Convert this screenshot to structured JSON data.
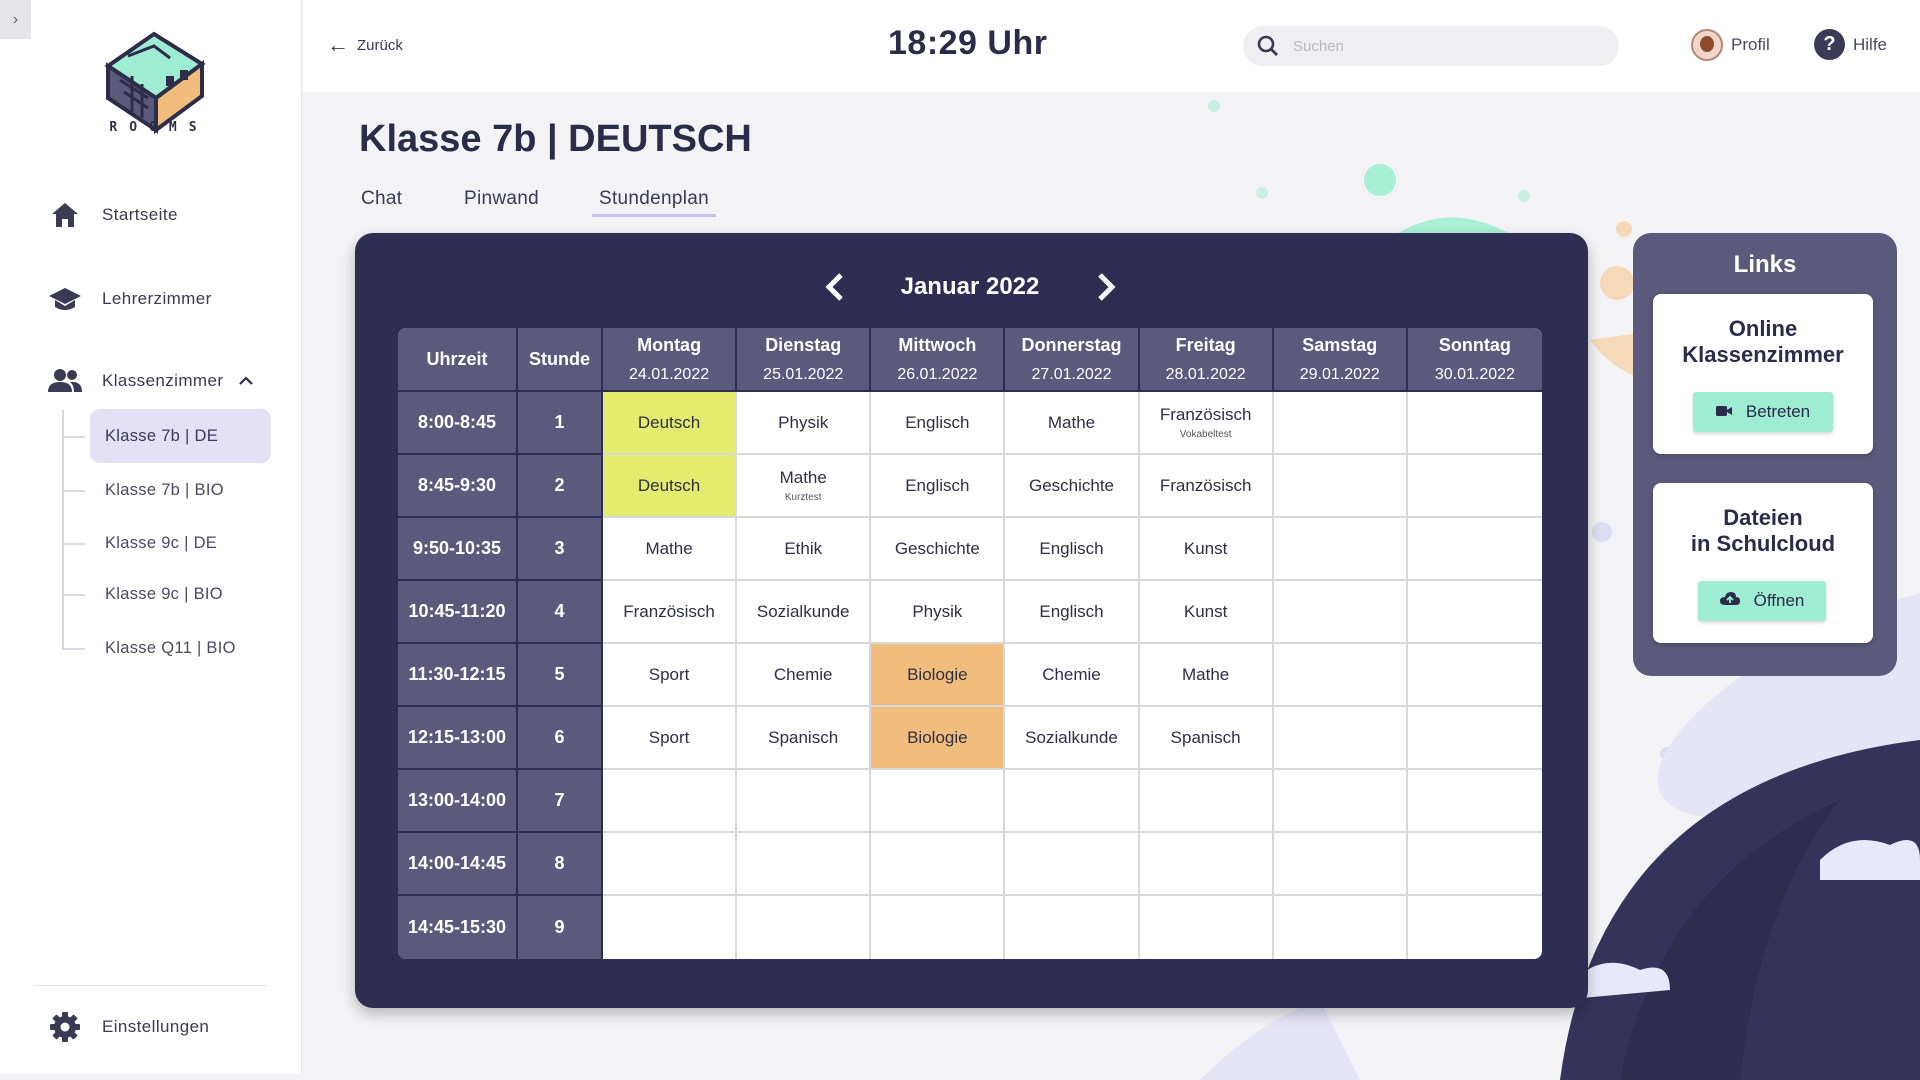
{
  "app": {
    "logo_text": "ROOMS"
  },
  "sidebar": {
    "nav": [
      {
        "label": "Startseite",
        "icon": "home-icon"
      },
      {
        "label": "Lehrerzimmer",
        "icon": "graduation-cap-icon"
      },
      {
        "label": "Klassenzimmer",
        "icon": "people-icon",
        "expanded": true
      }
    ],
    "classes": [
      {
        "label": "Klasse 7b | DE",
        "active": true
      },
      {
        "label": "Klasse 7b | BIO",
        "active": false
      },
      {
        "label": "Klasse 9c | DE",
        "active": false
      },
      {
        "label": "Klasse 9c | BIO",
        "active": false
      },
      {
        "label": "Klasse Q11 | BIO",
        "active": false
      }
    ],
    "settings_label": "Einstellungen"
  },
  "topbar": {
    "back_label": "Zurück",
    "clock": "18:29 Uhr",
    "search_placeholder": "Suchen",
    "profile_label": "Profil",
    "help_label": "Hilfe"
  },
  "page": {
    "title": "Klasse 7b | DEUTSCH",
    "tabs": [
      {
        "label": "Chat",
        "active": false
      },
      {
        "label": "Pinwand",
        "active": false
      },
      {
        "label": "Stundenplan",
        "active": true
      }
    ]
  },
  "timetable": {
    "month": "Januar 2022",
    "col_time": "Uhrzeit",
    "col_period": "Stunde",
    "days": [
      {
        "name": "Montag",
        "date": "24.01.2022"
      },
      {
        "name": "Dienstag",
        "date": "25.01.2022"
      },
      {
        "name": "Mittwoch",
        "date": "26.01.2022"
      },
      {
        "name": "Donnerstag",
        "date": "27.01.2022"
      },
      {
        "name": "Freitag",
        "date": "28.01.2022"
      },
      {
        "name": "Samstag",
        "date": "29.01.2022"
      },
      {
        "name": "Sonntag",
        "date": "30.01.2022"
      }
    ],
    "rows": [
      {
        "time": "8:00-8:45",
        "period": "1",
        "cells": [
          {
            "subject": "Deutsch",
            "highlight": "yellow"
          },
          {
            "subject": "Physik"
          },
          {
            "subject": "Englisch"
          },
          {
            "subject": "Mathe"
          },
          {
            "subject": "Französisch",
            "note": "Vokabeltest"
          },
          {
            "subject": ""
          },
          {
            "subject": ""
          }
        ]
      },
      {
        "time": "8:45-9:30",
        "period": "2",
        "cells": [
          {
            "subject": "Deutsch",
            "highlight": "yellow"
          },
          {
            "subject": "Mathe",
            "note": "Kurztest"
          },
          {
            "subject": "Englisch"
          },
          {
            "subject": "Geschichte"
          },
          {
            "subject": "Französisch"
          },
          {
            "subject": ""
          },
          {
            "subject": ""
          }
        ]
      },
      {
        "time": "9:50-10:35",
        "period": "3",
        "cells": [
          {
            "subject": "Mathe"
          },
          {
            "subject": "Ethik"
          },
          {
            "subject": "Geschichte"
          },
          {
            "subject": "Englisch"
          },
          {
            "subject": "Kunst"
          },
          {
            "subject": ""
          },
          {
            "subject": ""
          }
        ]
      },
      {
        "time": "10:45-11:20",
        "period": "4",
        "cells": [
          {
            "subject": "Französisch"
          },
          {
            "subject": "Sozialkunde"
          },
          {
            "subject": "Physik"
          },
          {
            "subject": "Englisch"
          },
          {
            "subject": "Kunst"
          },
          {
            "subject": ""
          },
          {
            "subject": ""
          }
        ]
      },
      {
        "time": "11:30-12:15",
        "period": "5",
        "cells": [
          {
            "subject": "Sport"
          },
          {
            "subject": "Chemie"
          },
          {
            "subject": "Biologie",
            "highlight": "orange"
          },
          {
            "subject": "Chemie"
          },
          {
            "subject": "Mathe"
          },
          {
            "subject": ""
          },
          {
            "subject": ""
          }
        ]
      },
      {
        "time": "12:15-13:00",
        "period": "6",
        "cells": [
          {
            "subject": "Sport"
          },
          {
            "subject": "Spanisch"
          },
          {
            "subject": "Biologie",
            "highlight": "orange"
          },
          {
            "subject": "Sozialkunde"
          },
          {
            "subject": "Spanisch"
          },
          {
            "subject": ""
          },
          {
            "subject": ""
          }
        ]
      },
      {
        "time": "13:00-14:00",
        "period": "7",
        "cells": [
          {
            "subject": ""
          },
          {
            "subject": ""
          },
          {
            "subject": ""
          },
          {
            "subject": ""
          },
          {
            "subject": ""
          },
          {
            "subject": ""
          },
          {
            "subject": ""
          }
        ]
      },
      {
        "time": "14:00-14:45",
        "period": "8",
        "cells": [
          {
            "subject": ""
          },
          {
            "subject": ""
          },
          {
            "subject": ""
          },
          {
            "subject": ""
          },
          {
            "subject": ""
          },
          {
            "subject": ""
          },
          {
            "subject": ""
          }
        ]
      },
      {
        "time": "14:45-15:30",
        "period": "9",
        "cells": [
          {
            "subject": ""
          },
          {
            "subject": ""
          },
          {
            "subject": ""
          },
          {
            "subject": ""
          },
          {
            "subject": ""
          },
          {
            "subject": ""
          },
          {
            "subject": ""
          }
        ]
      }
    ]
  },
  "links": {
    "title": "Links",
    "items": [
      {
        "title_line1": "Online",
        "title_line2": "Klassenzimmer",
        "button": "Betreten",
        "icon": "video-camera-icon"
      },
      {
        "title_line1": "Dateien",
        "title_line2": "in Schulcloud",
        "button": "Öffnen",
        "icon": "cloud-upload-icon"
      }
    ]
  },
  "colors": {
    "primary_dark": "#2f2d52",
    "header_purple": "#5b5a7c",
    "highlight_yellow": "#e2ec6e",
    "highlight_orange": "#f1bd7c",
    "button_mint": "#9eecd1",
    "active_nav": "#e4e1f7"
  }
}
